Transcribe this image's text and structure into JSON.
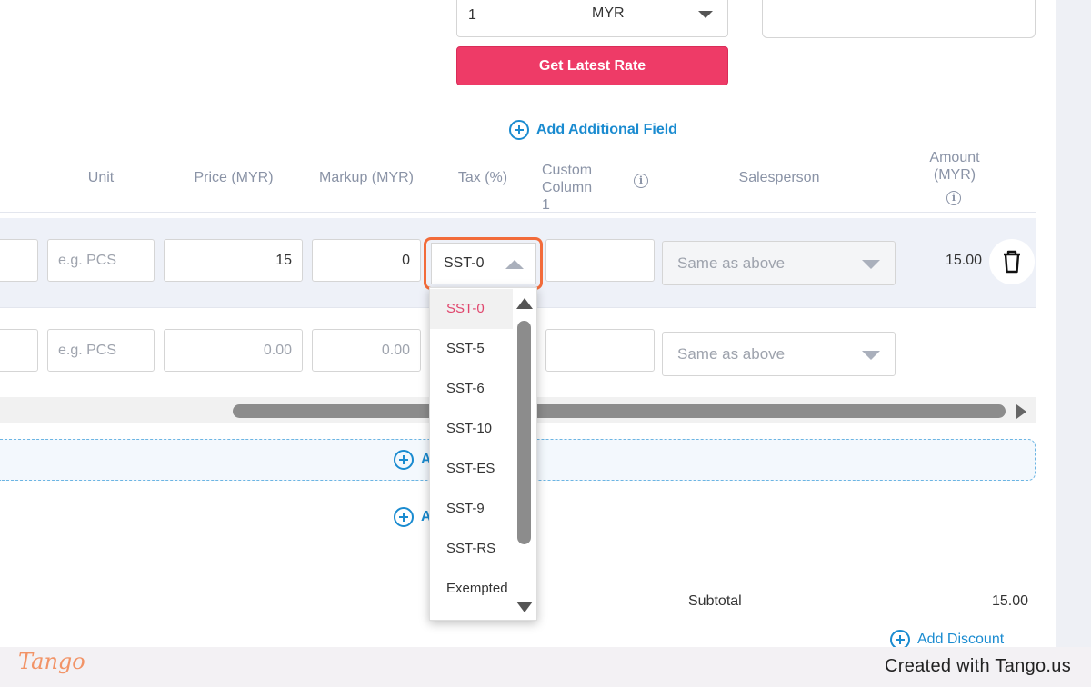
{
  "currency": {
    "quantity": "1",
    "code": "MYR"
  },
  "rate_button": "Get Latest Rate",
  "add_additional_field": "Add Additional Field",
  "table": {
    "headers": {
      "unit": "Unit",
      "price": "Price (MYR)",
      "markup": "Markup (MYR)",
      "tax": "Tax (%)",
      "custom_line1": "Custom",
      "custom_line2": "Column 1",
      "salesperson": "Salesperson",
      "amount_line1": "Amount",
      "amount_line2": "(MYR)"
    },
    "rows": [
      {
        "unit_placeholder": "e.g. PCS",
        "price": "15",
        "markup": "0",
        "tax": "SST-0",
        "custom": "",
        "salesperson": "Same as above",
        "amount": "15.00"
      },
      {
        "unit_placeholder": "e.g. PCS",
        "price": "0.00",
        "markup": "0.00",
        "custom": "",
        "salesperson": "Same as above"
      }
    ]
  },
  "tax_dropdown": {
    "selected": "SST-0",
    "options": [
      "SST-0",
      "SST-5",
      "SST-6",
      "SST-10",
      "SST-ES",
      "SST-9",
      "SST-RS",
      "Exempted"
    ]
  },
  "add_item_partial": "A",
  "add_section_partial": "A",
  "summary": {
    "subtotal_label": "Subtotal",
    "subtotal_value": "15.00",
    "add_discount": "Add Discount"
  },
  "footer": {
    "logo": "Tango",
    "created_with": "Created with Tango.us"
  },
  "colors": {
    "accent_pink": "#ee3b67",
    "link_blue": "#1a8bd0",
    "highlight_orange": "#f26b3a"
  }
}
